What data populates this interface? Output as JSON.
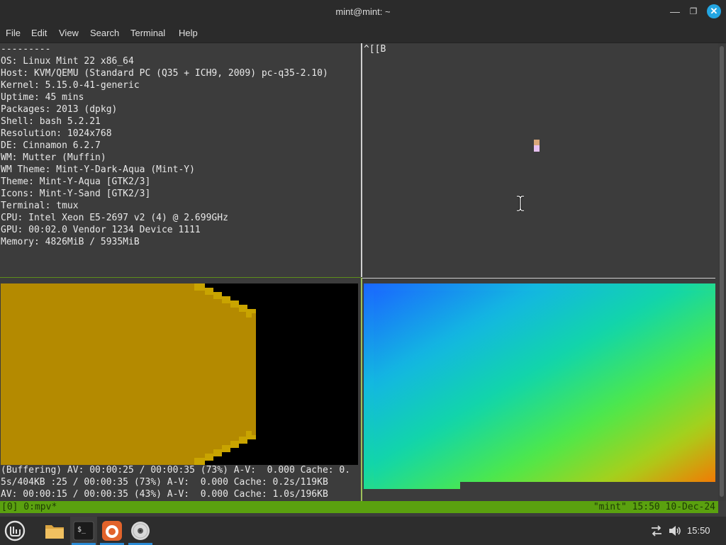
{
  "window": {
    "title": "mint@mint: ~"
  },
  "menu": [
    "File",
    "Edit",
    "View",
    "Search",
    "Terminal",
    "Help"
  ],
  "neofetch": [
    "---------",
    "OS: Linux Mint 22 x86_64",
    "Host: KVM/QEMU (Standard PC (Q35 + ICH9, 2009) pc-q35-2.10)",
    "Kernel: 5.15.0-41-generic",
    "Uptime: 45 mins",
    "Packages: 2013 (dpkg)",
    "Shell: bash 5.2.21",
    "Resolution: 1024x768",
    "DE: Cinnamon 6.2.7",
    "WM: Mutter (Muffin)",
    "WM Theme: Mint-Y-Dark-Aqua (Mint-Y)",
    "Theme: Mint-Y-Aqua [GTK2/3]",
    "Icons: Mint-Y-Sand [GTK2/3]",
    "Terminal: tmux",
    "CPU: Intel Xeon E5-2697 v2 (4) @ 2.699GHz",
    "GPU: 00:02.0 Vendor 1234 Device 1111",
    "Memory: 4826MiB / 5935MiB"
  ],
  "right_pane_text": "^[[B",
  "mpv_status": [
    "(Buffering) AV: 00:00:25 / 00:00:35 (73%) A-V:  0.000 Cache: 0.",
    "5s/404KB :25 / 00:00:35 (73%) A-V:  0.000 Cache: 0.2s/119KB",
    "AV: 00:00:15 / 00:00:35 (43%) A-V:  0.000 Cache: 1.0s/196KB"
  ],
  "tmux": {
    "left": "[0] 0:mpv*",
    "right": "\"mint\" 15:50 10-Dec-24"
  },
  "taskbar": {
    "clock": "15:50",
    "icons": [
      "mint-menu-icon",
      "files-icon",
      "terminal-icon",
      "firefox-icon",
      "disc-icon"
    ]
  },
  "colors": {
    "terminal_bg": "#3c3c3c",
    "tmux_bar": "#5aa10f",
    "accent": "#23a6e3",
    "video_gold": "#b48a00"
  }
}
